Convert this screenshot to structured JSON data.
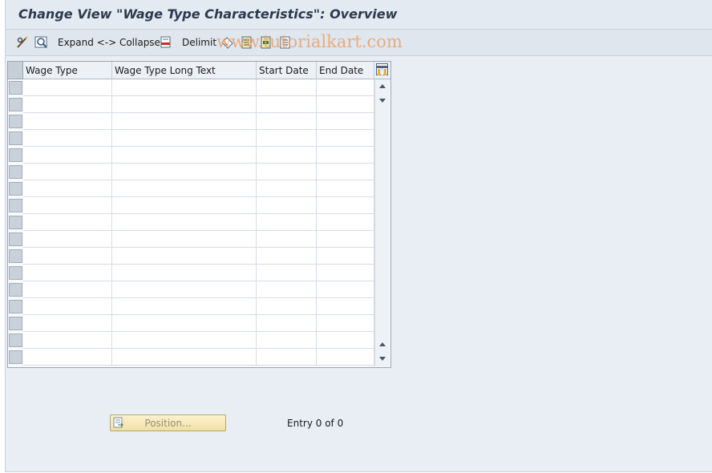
{
  "window": {
    "title": "Change View \"Wage Type Characteristics\": Overview"
  },
  "toolbar": {
    "expand_collapse_label": "Expand <-> Collapse",
    "delimit_label": "Delimit",
    "watermark": "www.tutorialkart.com"
  },
  "table": {
    "columns": [
      "Wage Type",
      "Wage Type Long Text",
      "Start Date",
      "End Date"
    ],
    "rows": []
  },
  "footer": {
    "position_button_label": "Position...",
    "entry_text": "Entry 0 of 0"
  },
  "icons": [
    "edit-glasses-icon",
    "find-icon",
    "delimit-icon",
    "where-used-icon",
    "select-all-icon",
    "select-block-icon",
    "deselect-all-icon",
    "column-config-icon",
    "position-icon",
    "scroll-up-icon",
    "scroll-down-icon"
  ]
}
